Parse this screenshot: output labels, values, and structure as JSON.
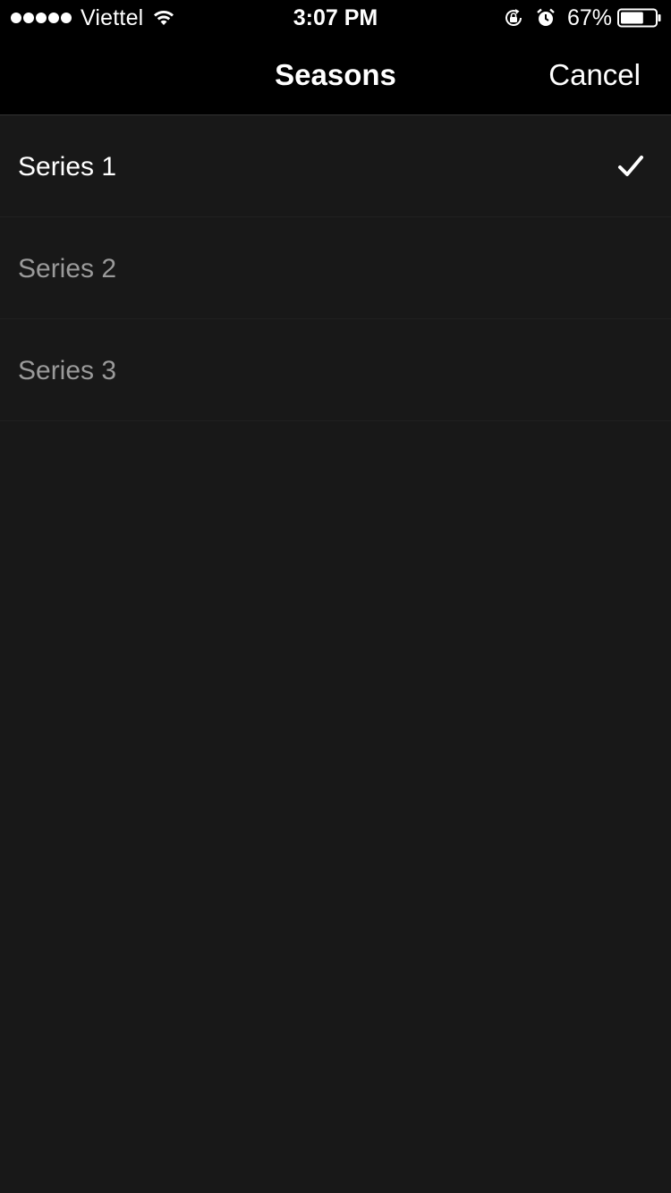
{
  "status_bar": {
    "carrier": "Viettel",
    "time": "3:07 PM",
    "battery_percent": "67%",
    "battery_level": 0.67,
    "icons": [
      "signal-dots-icon",
      "wifi-icon",
      "orientation-lock-icon",
      "alarm-icon",
      "battery-icon"
    ]
  },
  "nav": {
    "title": "Seasons",
    "cancel_label": "Cancel"
  },
  "seasons": [
    {
      "label": "Series 1",
      "selected": true
    },
    {
      "label": "Series 2",
      "selected": false
    },
    {
      "label": "Series 3",
      "selected": false
    }
  ],
  "colors": {
    "background": "#181818",
    "bar": "#000000",
    "selected_text": "#ffffff",
    "unselected_text": "#9a9a9a"
  }
}
